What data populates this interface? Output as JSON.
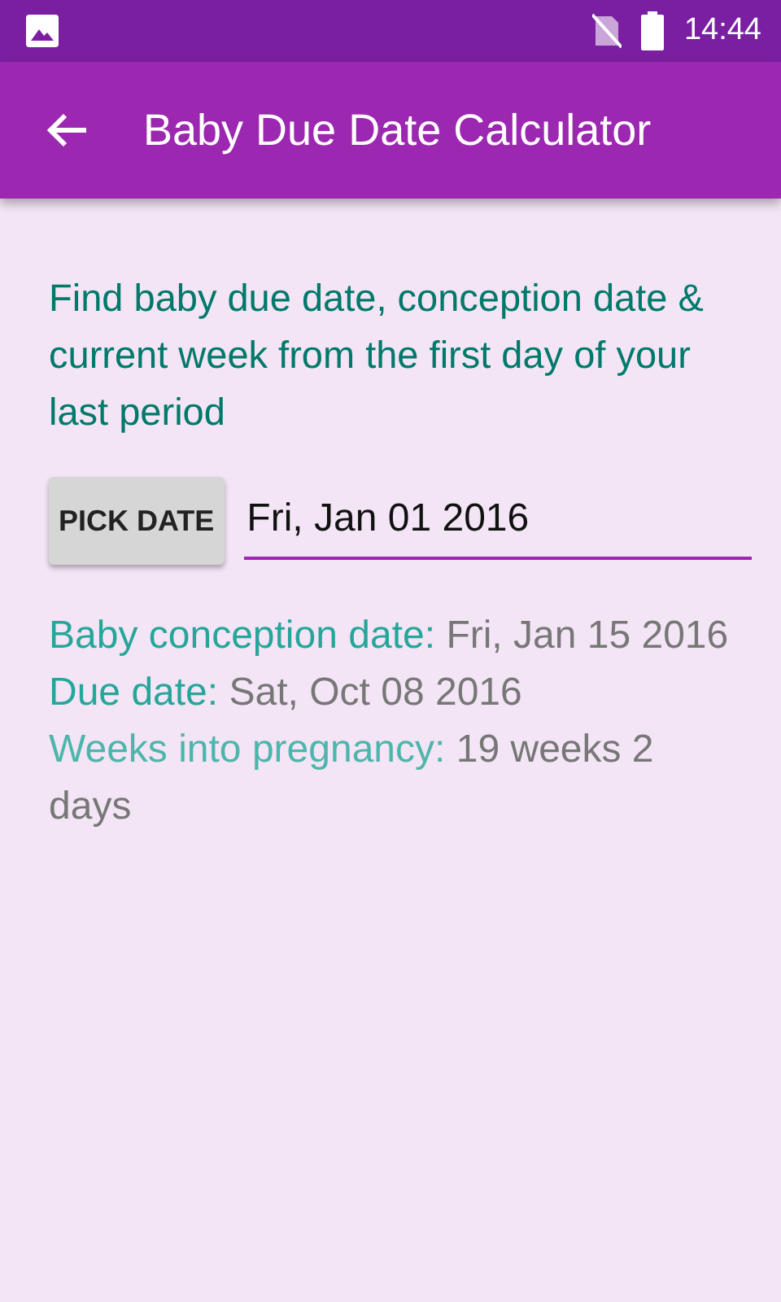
{
  "status_bar": {
    "time": "14:44"
  },
  "app_bar": {
    "title": "Baby Due Date Calculator"
  },
  "intro": "Find baby due date, conception date & current week from the first day of your last period",
  "pick_button": "PICK DATE",
  "date_field": {
    "value": "Fri, Jan 01 2016"
  },
  "results": [
    {
      "label": "Baby conception date:",
      "value": "Fri, Jan 15 2016",
      "color": "#26a69a"
    },
    {
      "label": "Due date:",
      "value": "Sat, Oct 08 2016",
      "color": "#26a69a"
    },
    {
      "label": "Weeks into pregnancy:",
      "value": "19 weeks 2 days",
      "color": "#4db6ac"
    }
  ]
}
